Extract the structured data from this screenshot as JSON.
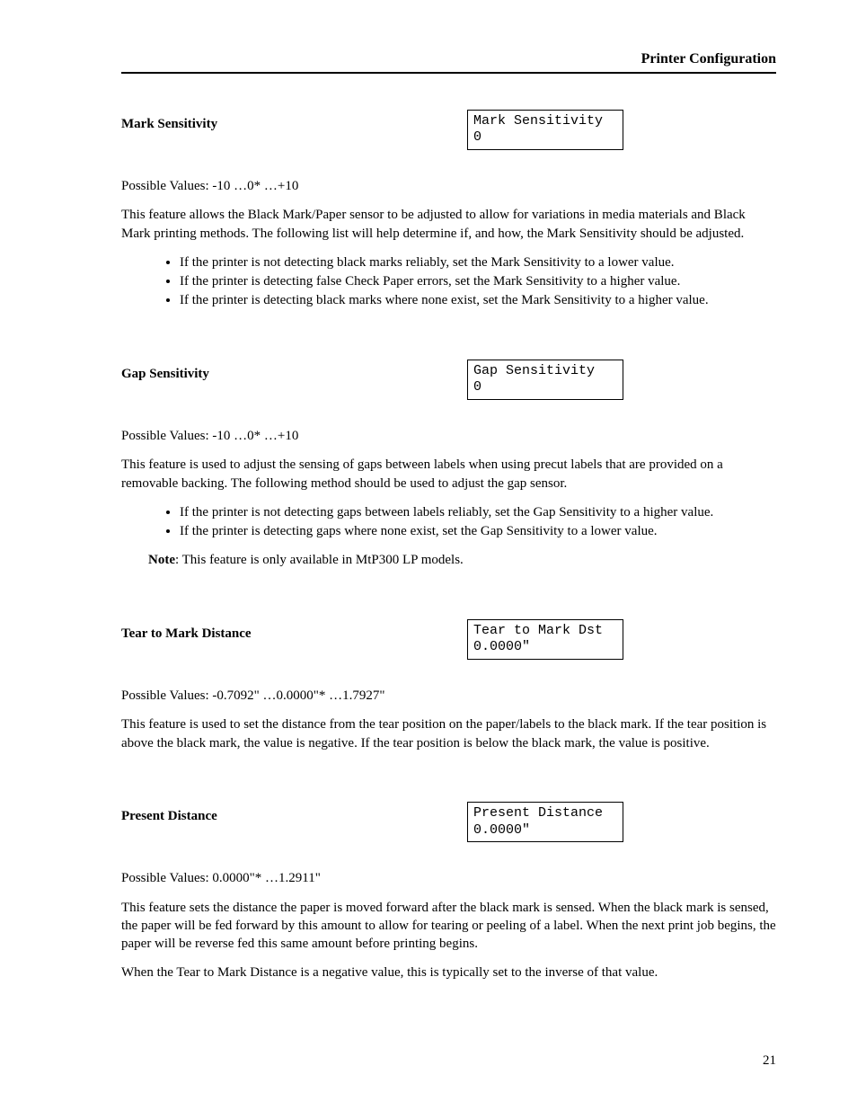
{
  "header": {
    "title": "Printer Configuration"
  },
  "sections": {
    "markSensitivity": {
      "title": "Mark Sensitivity",
      "display": {
        "line1": "Mark Sensitivity",
        "line2": "0"
      },
      "possibleValues": "Possible Values:  -10 …0* …+10",
      "intro": "This feature allows the Black Mark/Paper sensor to be adjusted to allow for variations in media materials and Black Mark printing methods.  The following list will help determine if, and how, the Mark Sensitivity should be adjusted.",
      "bullets": [
        "If the printer is not detecting black marks reliably, set the Mark Sensitivity to a lower value.",
        "If the printer is detecting false Check Paper errors, set the Mark Sensitivity to a higher value.",
        "If the printer is detecting black marks where none exist, set the Mark Sensitivity to a higher value."
      ]
    },
    "gapSensitivity": {
      "title": "Gap Sensitivity",
      "display": {
        "line1": "Gap Sensitivity",
        "line2": "0"
      },
      "possibleValues": "Possible Values:  -10 …0* …+10",
      "intro": "This feature is used to adjust the sensing of gaps between labels when using precut labels that are provided on a removable backing.  The following method should be used to adjust the gap sensor.",
      "bullets": [
        "If the printer is not detecting gaps between labels reliably, set the Gap Sensitivity to a higher value.",
        "If the printer is detecting gaps where none exist, set the Gap Sensitivity to a lower value."
      ],
      "noteLabel": "Note",
      "noteText": ": This feature is only available in MtP300 LP models."
    },
    "tearToMark": {
      "title": "Tear to Mark Distance",
      "display": {
        "line1": "Tear to Mark Dst",
        "line2": "0.0000\""
      },
      "possibleValues": "Possible Values:  -0.7092\" …0.0000\"* …1.7927\"",
      "intro": "This feature is used to set the distance from the tear position on the paper/labels to the black mark.  If the tear position is above the black mark, the value is negative.  If the tear position is below the black mark, the value is positive."
    },
    "presentDistance": {
      "title": "Present Distance",
      "display": {
        "line1": "Present Distance",
        "line2": "0.0000\""
      },
      "possibleValues": "Possible Values:  0.0000\"* …1.2911\"",
      "intro": "This feature sets the distance the paper is moved forward after the black mark is sensed.  When the black mark is sensed, the paper will be fed forward by this amount to allow for tearing or peeling of a label.  When the next print job begins, the paper will be reverse fed this same amount before printing begins.",
      "para2": "When the Tear to Mark Distance is a negative value, this is typically set to the inverse of that value."
    }
  },
  "pageNumber": "21"
}
